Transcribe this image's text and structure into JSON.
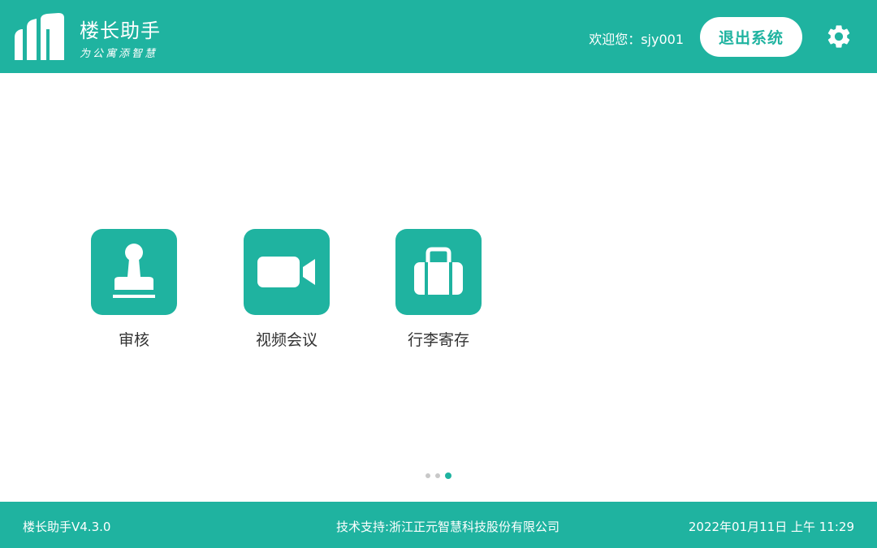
{
  "header": {
    "app_title": "楼长助手",
    "slogan": "为公寓添智慧",
    "welcome": "欢迎您：sjy001",
    "logout_label": "退出系统",
    "accent_color": "#1fb3a0"
  },
  "apps": [
    {
      "label": "审核",
      "icon": "stamp-icon"
    },
    {
      "label": "视频会议",
      "icon": "video-camera-icon"
    },
    {
      "label": "行李寄存",
      "icon": "luggage-icon"
    }
  ],
  "pager": {
    "pages": 3,
    "current": 3
  },
  "footer": {
    "version": "楼长助手V4.3.0",
    "support": "技术支持:浙江正元智慧科技股份有限公司",
    "datetime": "2022年01月11日 上午 11:29"
  }
}
